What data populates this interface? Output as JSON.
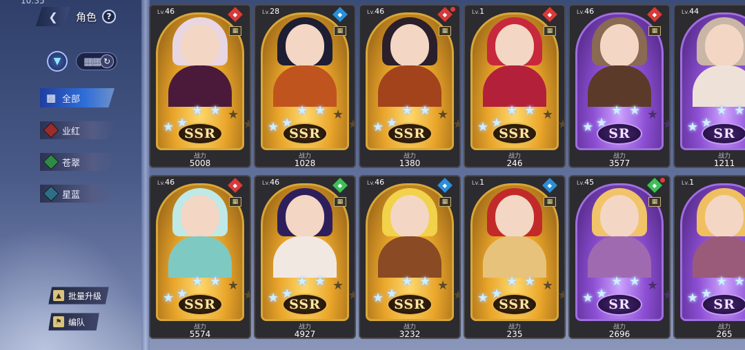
{
  "header": {
    "time": "10:35",
    "title": "角色",
    "help": "?",
    "back_icon": "back-arrow-icon"
  },
  "filters": [
    {
      "label": "全部",
      "color": "#2f6ed8",
      "active": true
    },
    {
      "label": "业红",
      "color": "#9c2b2b",
      "active": false
    },
    {
      "label": "苍翠",
      "color": "#2e8a45",
      "active": false
    },
    {
      "label": "星蓝",
      "color": "#2c6f86",
      "active": false
    }
  ],
  "buttons": {
    "batch_upgrade": "批量升级",
    "team": "编队"
  },
  "power_label": "战力",
  "cards": [
    {
      "level": "46",
      "rarity": "SSR",
      "power": "5008",
      "element_color": "#d83a3a",
      "element_icon": "flame",
      "stars": 3,
      "has_dot": false,
      "hair": "#e8d7e2",
      "body": "#4b1a3a"
    },
    {
      "level": "28",
      "rarity": "SSR",
      "power": "1028",
      "element_color": "#2c8ed8",
      "element_icon": "wave",
      "stars": 3,
      "has_dot": false,
      "hair": "#1d1d33",
      "body": "#c0541f"
    },
    {
      "level": "46",
      "rarity": "SSR",
      "power": "1380",
      "element_color": "#d83a3a",
      "element_icon": "flame",
      "stars": 3,
      "has_dot": true,
      "hair": "#2a1f2a",
      "body": "#a3431c"
    },
    {
      "level": "1",
      "rarity": "SSR",
      "power": "246",
      "element_color": "#d83a3a",
      "element_icon": "shield",
      "stars": 3,
      "has_dot": false,
      "hair": "#c8283c",
      "body": "#b3203a"
    },
    {
      "level": "46",
      "rarity": "SR",
      "power": "3577",
      "element_color": "#d83a3a",
      "element_icon": "sword",
      "stars": 3,
      "has_dot": false,
      "hair": "#8a6a52",
      "body": "#5c3a2a"
    },
    {
      "level": "44",
      "rarity": "SR",
      "power": "1211",
      "element_color": "#d83a3a",
      "element_icon": "shield",
      "stars": 3,
      "has_dot": false,
      "hair": "#c9b6a6",
      "body": "#eee2d8"
    },
    {
      "level": "46",
      "rarity": "SSR",
      "power": "5574",
      "element_color": "#d83a3a",
      "element_icon": "sword",
      "stars": 3,
      "has_dot": false,
      "hair": "#bfe9e6",
      "body": "#7ec9c2"
    },
    {
      "level": "46",
      "rarity": "SSR",
      "power": "4927",
      "element_color": "#3fbf5a",
      "element_icon": "leaf",
      "stars": 3,
      "has_dot": false,
      "hair": "#2e1f5c",
      "body": "#f2e8e2"
    },
    {
      "level": "46",
      "rarity": "SSR",
      "power": "3232",
      "element_color": "#2c8ed8",
      "element_icon": "sword",
      "stars": 3,
      "has_dot": false,
      "hair": "#f1d24a",
      "body": "#8a4a24"
    },
    {
      "level": "1",
      "rarity": "SSR",
      "power": "235",
      "element_color": "#2c8ed8",
      "element_icon": "wave",
      "stars": 3,
      "has_dot": false,
      "hair": "#c22a2a",
      "body": "#e7c27a"
    },
    {
      "level": "45",
      "rarity": "SR",
      "power": "2696",
      "element_color": "#3fbf5a",
      "element_icon": "sword",
      "stars": 3,
      "has_dot": true,
      "hair": "#f1c46a",
      "body": "#a06ab0"
    },
    {
      "level": "1",
      "rarity": "SR",
      "power": "265",
      "element_color": "#3fbf5a",
      "element_icon": "leaf",
      "stars": 3,
      "has_dot": false,
      "hair": "#f0c060",
      "body": "#9a5a7a"
    }
  ]
}
